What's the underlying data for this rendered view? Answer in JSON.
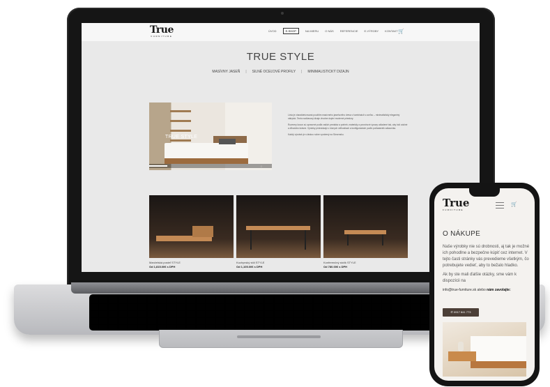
{
  "laptop_site": {
    "logo": {
      "main": "True",
      "sub": "FURNITURE"
    },
    "menu": [
      "ÚVOD",
      "E-SHOP",
      "NA MIERU",
      "O NÁS",
      "REFERENCIE",
      "E-VÝROBY",
      "KONTAKT"
    ],
    "active_menu": "E-SHOP",
    "hero_title": "TRUE STYLE",
    "subnav": [
      "MASÍVNY JASEŇ",
      "SILNÉ OCEĽOVÉ PROFILY",
      "MINIMALISTICKÝ DIZAJN"
    ],
    "video": {
      "caption": "TRUE STYLE",
      "progress": 0.15
    },
    "paragraphs": [
      "Línia je charakterizovaná použitím masívneho jaseňového dreva v kombinácii s oceľou – minimalistický elegantný nábytok. Tento nadčasový dizajn vhodne doplní moderné priestory.",
      "Rozmery kusov sú upravené podľa vašich predstáv a potrieb, materiály a povrchové úpravy odladené tak, aby boli odolné a dlhodobo krásne. Výrobky prichádzajú v rôznych veľkostiach a konfiguráciách podľa požiadaviek zákazníka.",
      "Každý výrobok je s láskou ručne vyrobený na Slovensku."
    ],
    "products": [
      {
        "name": "Manželská posteľ STYLE",
        "price": "Od 1,815.00€ s DPH"
      },
      {
        "name": "Kuchynský stôl STYLE",
        "price": "Od 1,105.00€ s DPH"
      },
      {
        "name": "Konferenčný stolík STYLE",
        "price": "Od 780.00€ s DPH"
      }
    ]
  },
  "phone_site": {
    "logo": {
      "main": "True",
      "sub": "FURNITURE"
    },
    "title": "O NÁKUPE",
    "paragraphs": [
      "Naše výrobky nie sú drobnosti, aj tak je možné ich pohodlne a bezpečne kúpiť cez internet. V tejto časti stránky vás prevedieme všetkým, čo potrebujete vedieť, aby to bežalo hladko.",
      "Ak by ste mali ďalšie otázky, sme vám k dispozícii na"
    ],
    "contact_prefix": "info@true-furniture.sk alebo ",
    "contact_bold": "nám zavolajte:",
    "phone_button": "✆ 0917 841 773"
  },
  "colors": {
    "button": "#4c3f37",
    "accent_wood": "#c48a55"
  }
}
